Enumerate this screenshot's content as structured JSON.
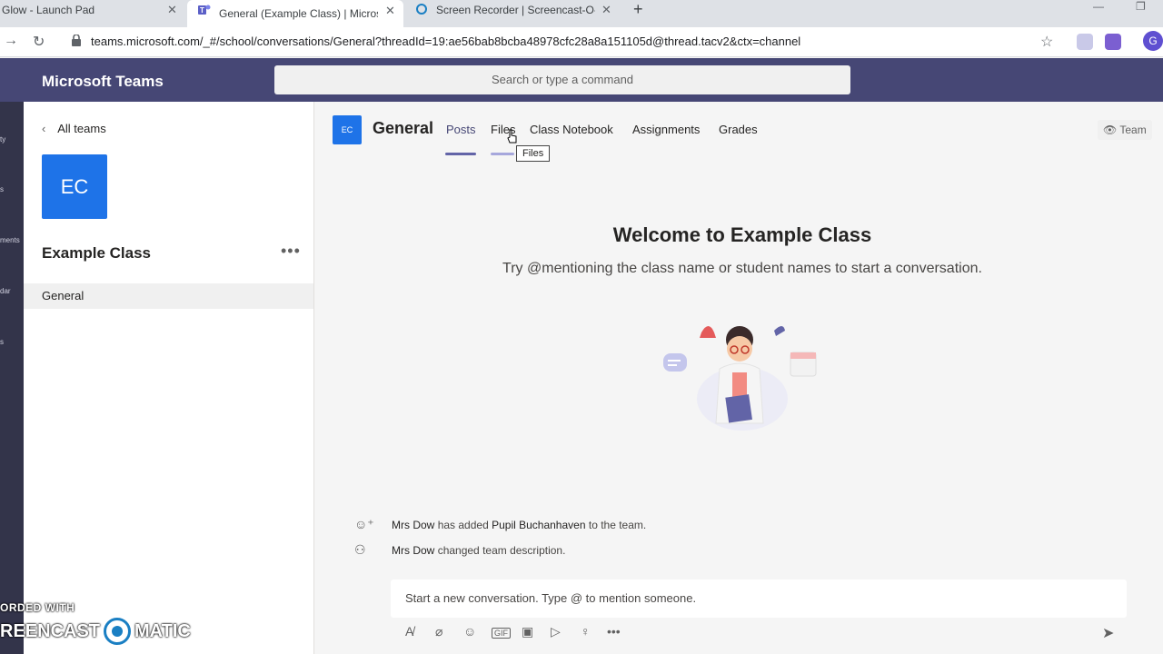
{
  "browser": {
    "tabs": [
      {
        "title": "Glow - Launch Pad",
        "close": "✕"
      },
      {
        "title": "General (Example Class) | Micros",
        "close": "✕"
      },
      {
        "title": "Screen Recorder | Screencast-O-",
        "close": "✕"
      }
    ],
    "new_tab": "+",
    "url": "teams.microsoft.com/_#/school/conversations/General?threadId=19:ae56bab8bcba48978cfc28a8a151105d@thread.tacv2&ctx=channel",
    "profile_initial": "G"
  },
  "app": {
    "title": "Microsoft Teams",
    "search_placeholder": "Search or type a command"
  },
  "rail_fragments": [
    "ty",
    "s",
    "ments",
    "dar",
    "s"
  ],
  "teampane": {
    "back_label": "All teams",
    "avatar_initials": "EC",
    "team_name": "Example Class",
    "more": "•••",
    "channels": [
      "General"
    ]
  },
  "channel": {
    "avatar_initials": "EC",
    "title": "General",
    "tabs": [
      "Posts",
      "Files",
      "Class Notebook",
      "Assignments",
      "Grades"
    ],
    "tooltip": "Files",
    "team_button": "Team"
  },
  "welcome": {
    "title": "Welcome to Example Class",
    "subtitle": "Try @mentioning the class name or student names to start a conversation."
  },
  "activity": [
    {
      "actor": "Mrs Dow",
      "action": "has added",
      "target": "Pupil Buchanhaven",
      "tail": "to the team."
    },
    {
      "actor": "Mrs Dow",
      "action": "changed team description.",
      "target": "",
      "tail": ""
    }
  ],
  "compose": {
    "placeholder": "Start a new conversation. Type @ to mention someone."
  },
  "watermark": {
    "line1": "ORDED WITH",
    "left": "REENCAST",
    "right": "MATIC"
  },
  "colors": {
    "teams_header": "#464775",
    "accent": "#6264a7",
    "team_avatar": "#1e73e8"
  }
}
